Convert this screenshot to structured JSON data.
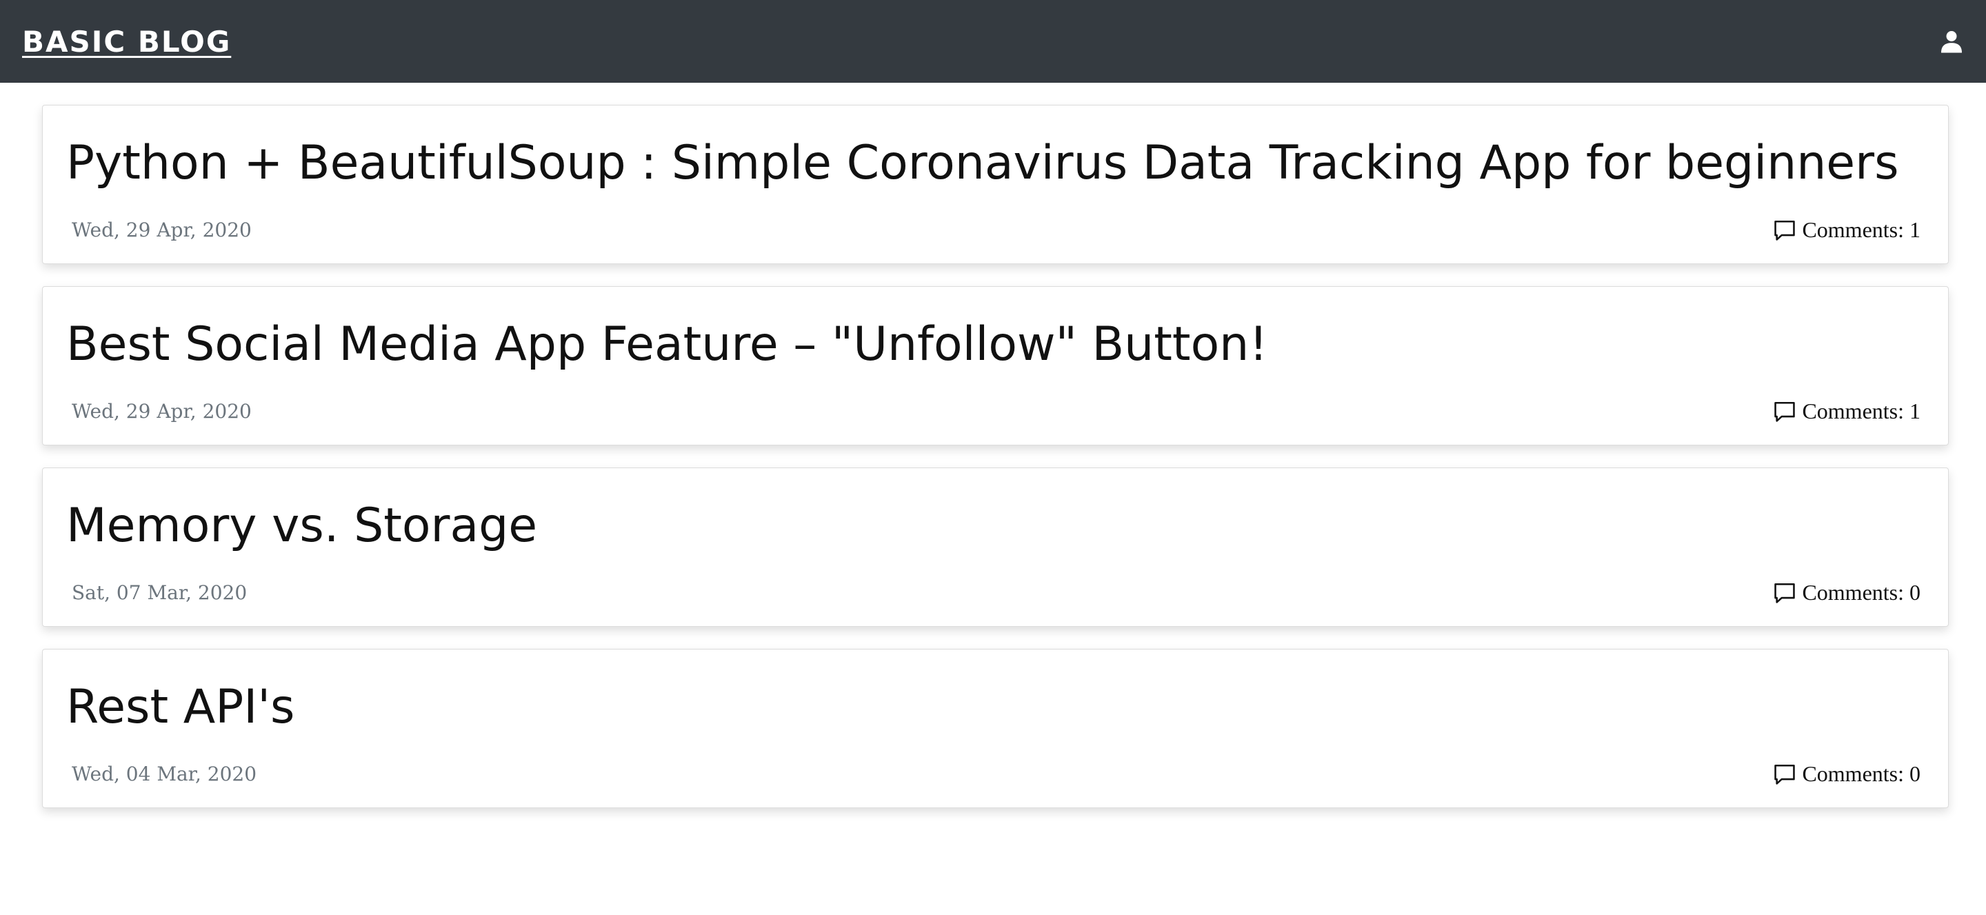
{
  "navbar": {
    "brand": "BASIC BLOG",
    "user_icon": "user-icon"
  },
  "posts": [
    {
      "title": "Python + BeautifulSoup : Simple Coronavirus Data Tracking App for beginners",
      "date": "Wed, 29 Apr, 2020",
      "comments_label": "Comments:",
      "comments_count": "1"
    },
    {
      "title": "Best Social Media App Feature – \"Unfollow\" Button!",
      "date": "Wed, 29 Apr, 2020",
      "comments_label": "Comments:",
      "comments_count": "1"
    },
    {
      "title": "Memory vs. Storage",
      "date": "Sat, 07 Mar, 2020",
      "comments_label": "Comments:",
      "comments_count": "0"
    },
    {
      "title": "Rest API's",
      "date": "Wed, 04 Mar, 2020",
      "comments_label": "Comments:",
      "comments_count": "0"
    }
  ],
  "colors": {
    "navbar_bg": "#343a40",
    "date_text": "#6c757d"
  },
  "icons": {
    "comment": "comment-icon"
  }
}
